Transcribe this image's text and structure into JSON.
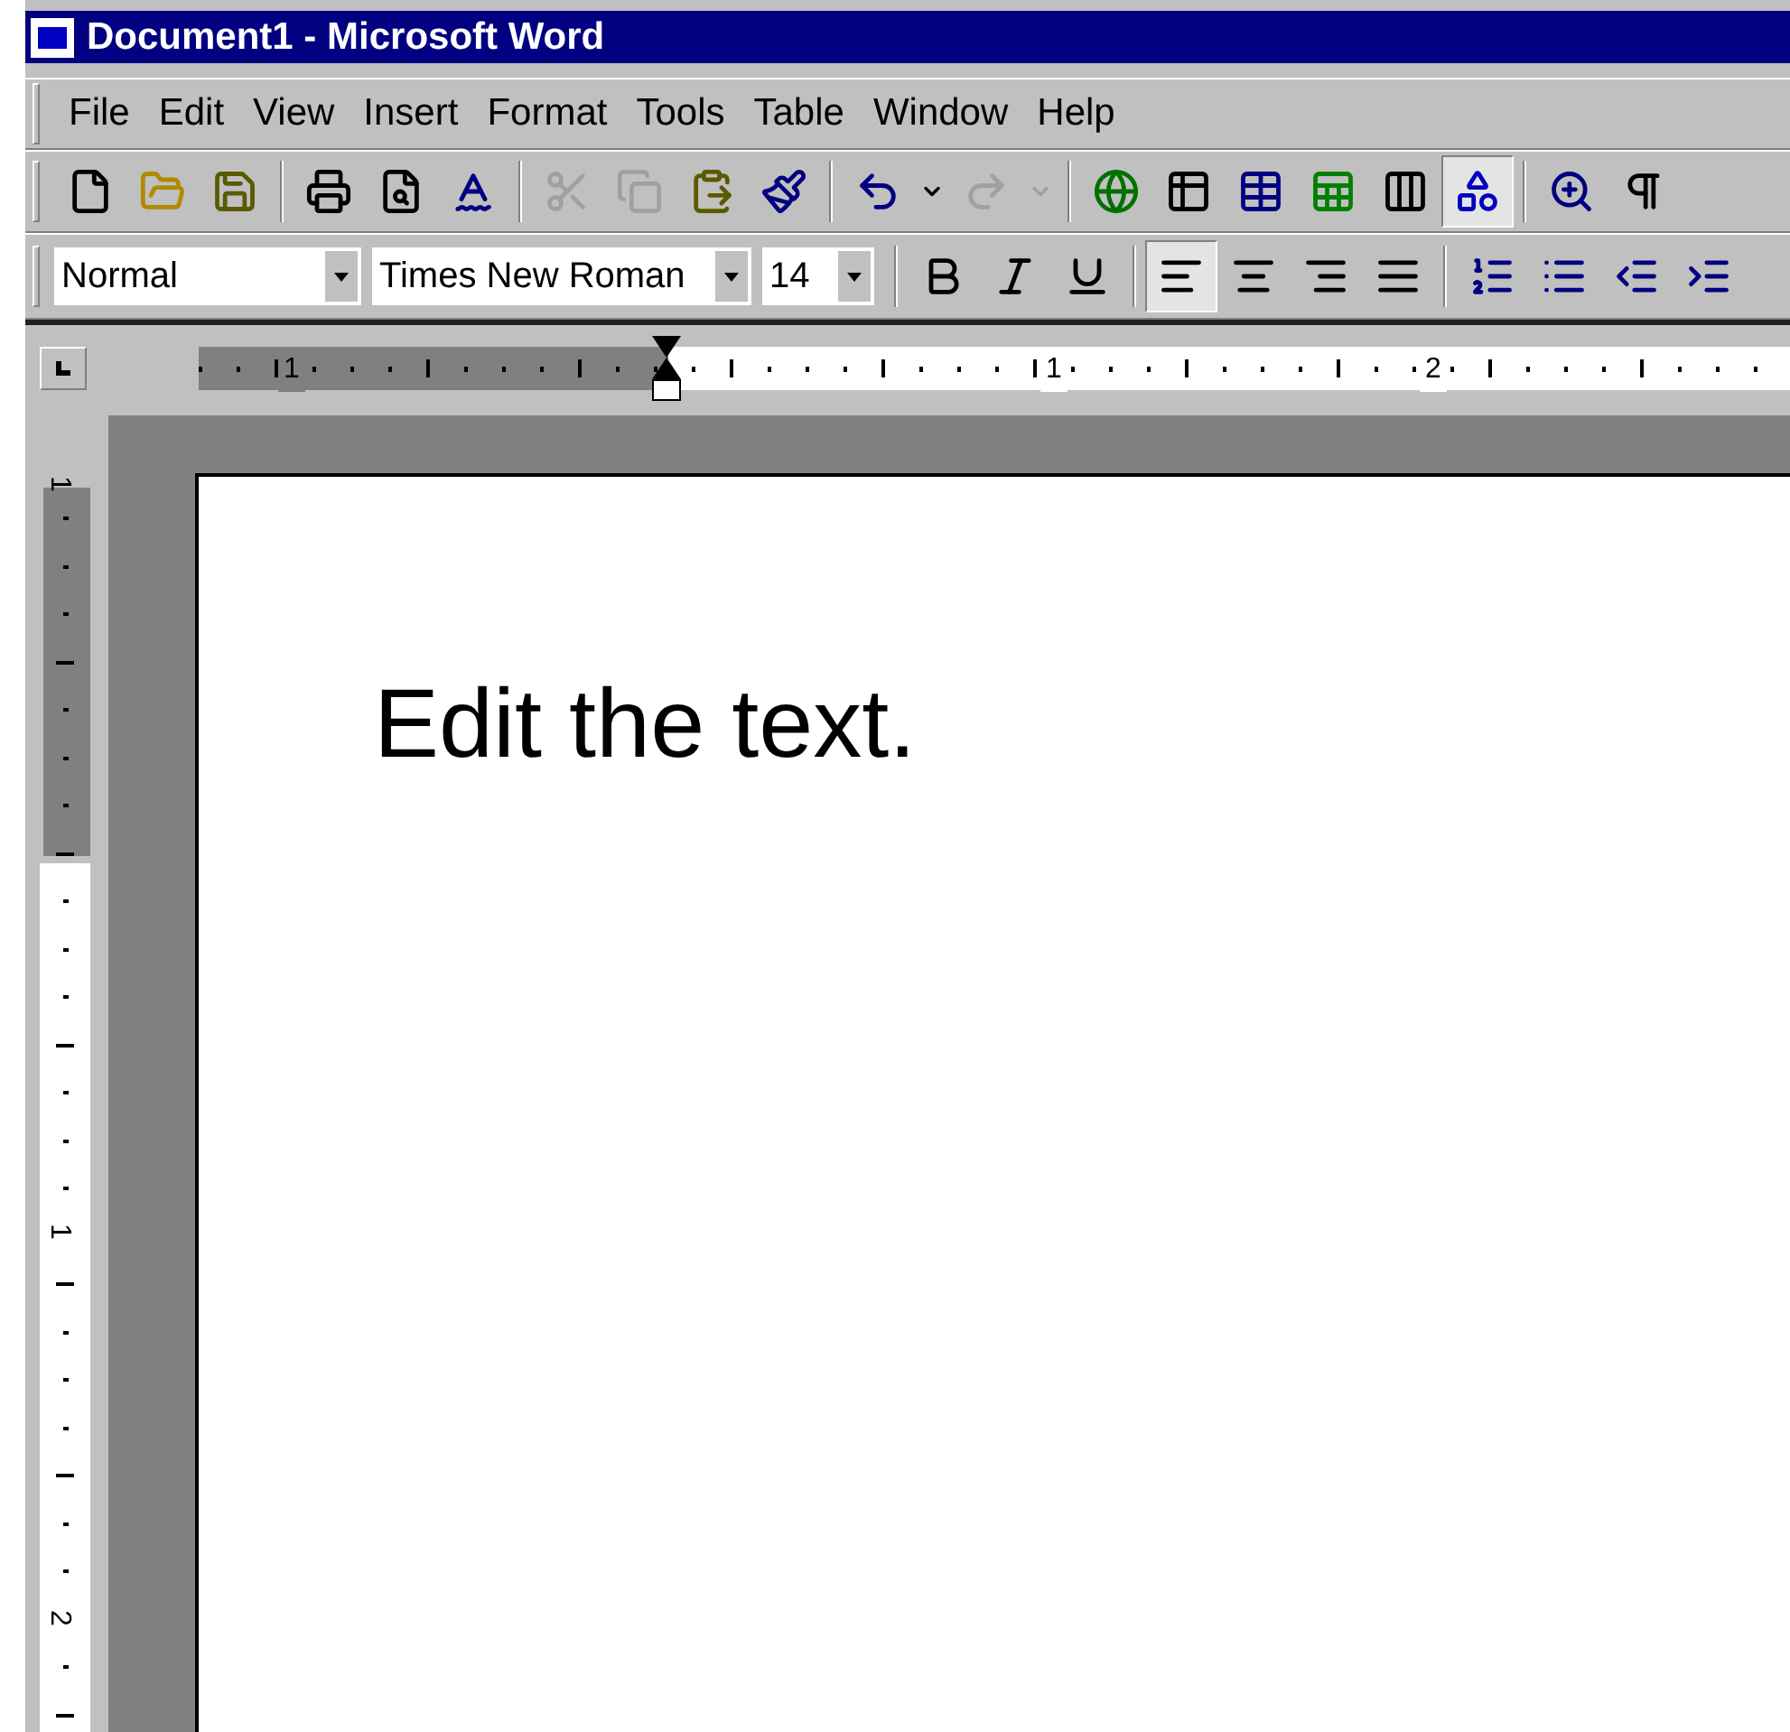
{
  "window": {
    "title": "Document1 - Microsoft Word"
  },
  "menu": [
    "File",
    "Edit",
    "View",
    "Insert",
    "Format",
    "Tools",
    "Table",
    "Window",
    "Help"
  ],
  "standard_toolbar": [
    {
      "kind": "new",
      "pressed": false,
      "disabled": false
    },
    {
      "kind": "open",
      "pressed": false,
      "disabled": false
    },
    {
      "kind": "save",
      "pressed": false,
      "disabled": false
    },
    {
      "kind": "separator"
    },
    {
      "kind": "print",
      "pressed": false,
      "disabled": false
    },
    {
      "kind": "preview",
      "pressed": false,
      "disabled": false
    },
    {
      "kind": "spelling",
      "pressed": false,
      "disabled": false
    },
    {
      "kind": "separator"
    },
    {
      "kind": "cut",
      "pressed": false,
      "disabled": true
    },
    {
      "kind": "copy",
      "pressed": false,
      "disabled": true
    },
    {
      "kind": "paste",
      "pressed": false,
      "disabled": false
    },
    {
      "kind": "format-painter",
      "pressed": false,
      "disabled": false
    },
    {
      "kind": "separator"
    },
    {
      "kind": "undo",
      "pressed": false,
      "disabled": false
    },
    {
      "kind": "dropdown",
      "pressed": false,
      "disabled": false
    },
    {
      "kind": "redo",
      "pressed": false,
      "disabled": true
    },
    {
      "kind": "dropdown",
      "pressed": false,
      "disabled": true
    },
    {
      "kind": "separator"
    },
    {
      "kind": "hyperlink",
      "pressed": false,
      "disabled": false
    },
    {
      "kind": "draw-table",
      "pressed": false,
      "disabled": false
    },
    {
      "kind": "table",
      "pressed": false,
      "disabled": false
    },
    {
      "kind": "spreadsheet",
      "pressed": false,
      "disabled": false
    },
    {
      "kind": "columns",
      "pressed": false,
      "disabled": false
    },
    {
      "kind": "drawing",
      "pressed": true,
      "disabled": false
    },
    {
      "kind": "separator"
    },
    {
      "kind": "document-map",
      "pressed": false,
      "disabled": false
    },
    {
      "kind": "pilcrow",
      "pressed": false,
      "disabled": false
    }
  ],
  "formatting_toolbar": {
    "style": "Normal",
    "font": "Times New Roman",
    "size": "14",
    "buttons": [
      {
        "kind": "bold",
        "pressed": false
      },
      {
        "kind": "italic",
        "pressed": false
      },
      {
        "kind": "underline",
        "pressed": false
      },
      {
        "kind": "separator"
      },
      {
        "kind": "align-left",
        "pressed": true
      },
      {
        "kind": "align-center",
        "pressed": false
      },
      {
        "kind": "align-right",
        "pressed": false
      },
      {
        "kind": "justify",
        "pressed": false
      },
      {
        "kind": "separator"
      },
      {
        "kind": "numbering",
        "pressed": false
      },
      {
        "kind": "bullets",
        "pressed": false
      },
      {
        "kind": "outdent",
        "pressed": false
      },
      {
        "kind": "indent",
        "pressed": false
      }
    ]
  },
  "horizontal_ruler": {
    "labels": [
      "1",
      "1",
      "2"
    ]
  },
  "vertical_ruler": {
    "labels": [
      "1",
      "1",
      "2"
    ]
  },
  "document": {
    "text": "Edit the text."
  }
}
